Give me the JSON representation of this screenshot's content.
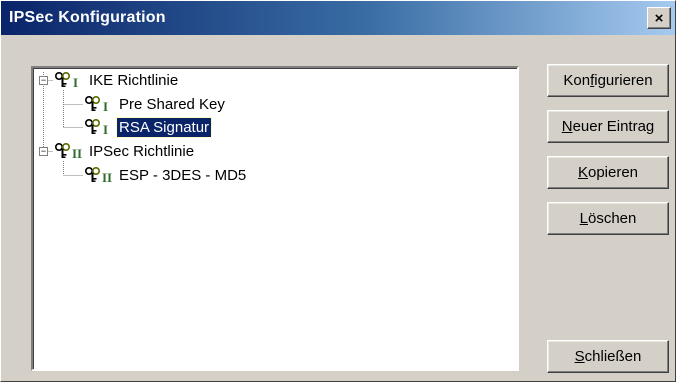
{
  "window": {
    "title": "IPSec Konfiguration",
    "close_glyph": "×"
  },
  "tree": {
    "nodes": [
      {
        "label": "IKE Richtlinie",
        "level": 0,
        "expanded": true,
        "icon": "key-policy-icon-I",
        "selected": false
      },
      {
        "label": "Pre Shared Key",
        "level": 1,
        "icon": "key-policy-icon-I",
        "selected": false
      },
      {
        "label": "RSA Signatur",
        "level": 1,
        "icon": "key-policy-icon-I",
        "selected": true
      },
      {
        "label": "IPSec Richtlinie",
        "level": 0,
        "expanded": true,
        "icon": "key-policy-icon-II",
        "selected": false
      },
      {
        "label": "ESP - 3DES - MD5",
        "level": 1,
        "icon": "key-policy-icon-II",
        "selected": false
      }
    ]
  },
  "buttons": {
    "configure": {
      "pre": "Kon",
      "mnemonic": "f",
      "post": "igurieren"
    },
    "new_entry": {
      "pre": "",
      "mnemonic": "N",
      "post": "euer Eintrag"
    },
    "copy": {
      "pre": "",
      "mnemonic": "K",
      "post": "opieren"
    },
    "delete": {
      "pre": "",
      "mnemonic": "L",
      "post": "öschen"
    },
    "close": {
      "pre": "",
      "mnemonic": "S",
      "post": "chließen"
    }
  },
  "colors": {
    "selection_bg": "#0a246a",
    "title_gradient_start": "#0a246a",
    "title_gradient_end": "#a6caf0",
    "face": "#d4d0c8"
  }
}
